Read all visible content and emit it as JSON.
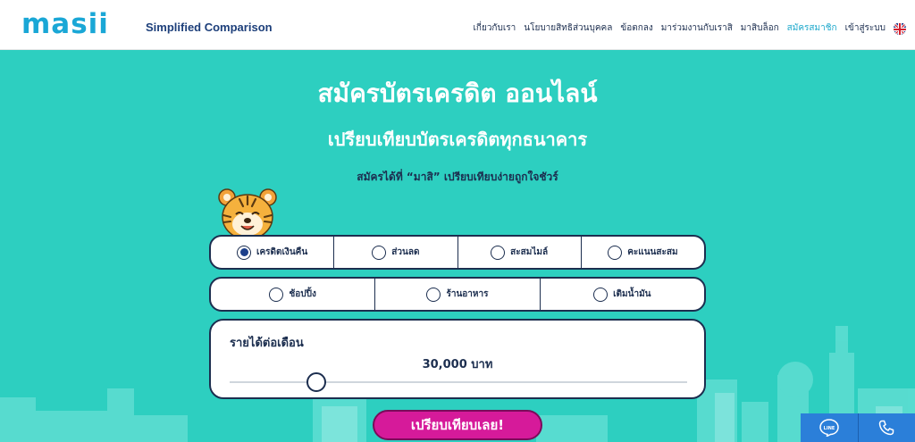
{
  "header": {
    "logo": "masii",
    "tagline": "Simplified Comparison",
    "nav": [
      {
        "label": "เกี่ยวกับเรา",
        "active": false
      },
      {
        "label": "นโยบายสิทธิส่วนบุคคล",
        "active": false
      },
      {
        "label": "ข้อตกลง",
        "active": false
      },
      {
        "label": "มาร่วมงานกับเราสิ",
        "active": false
      },
      {
        "label": "มาสิบล็อก",
        "active": false
      },
      {
        "label": "สมัครสมาชิก",
        "active": true
      },
      {
        "label": "เข้าสู่ระบบ",
        "active": false
      }
    ],
    "language_icon": "uk-flag-icon"
  },
  "hero": {
    "title": "สมัครบัตรเครดิต ออนไลน์",
    "subtitle": "เปรียบเทียบบัตรเครดิตทุกธนาคาร",
    "tagline": "สมัครได้ที่ “มาสิ” เปรียบเทียบง่ายถูกใจชัวร์"
  },
  "card_types_row1": [
    {
      "label": "เครดิตเงินคืน",
      "selected": true
    },
    {
      "label": "ส่วนลด",
      "selected": false
    },
    {
      "label": "สะสมไมล์",
      "selected": false
    },
    {
      "label": "คะแนนสะสม",
      "selected": false
    }
  ],
  "card_types_row2": [
    {
      "label": "ช้อปปิ้ง",
      "selected": false
    },
    {
      "label": "ร้านอาหาร",
      "selected": false
    },
    {
      "label": "เติมน้ำมัน",
      "selected": false
    }
  ],
  "income": {
    "label": "รายได้ต่อเดือน",
    "value": "30,000 บาท",
    "slider_fraction": 0.19
  },
  "compare_button": "เปรียบเทียบเลย!",
  "floating": {
    "line_icon": "line-icon",
    "line_text": "LINE",
    "phone_icon": "phone-icon"
  },
  "colors": {
    "background": "#2dcfc0",
    "navy": "#1c2e4f",
    "magenta": "#d61a9a",
    "logo_blue": "#1aa7d6",
    "float_blue": "#2b7fd9"
  }
}
